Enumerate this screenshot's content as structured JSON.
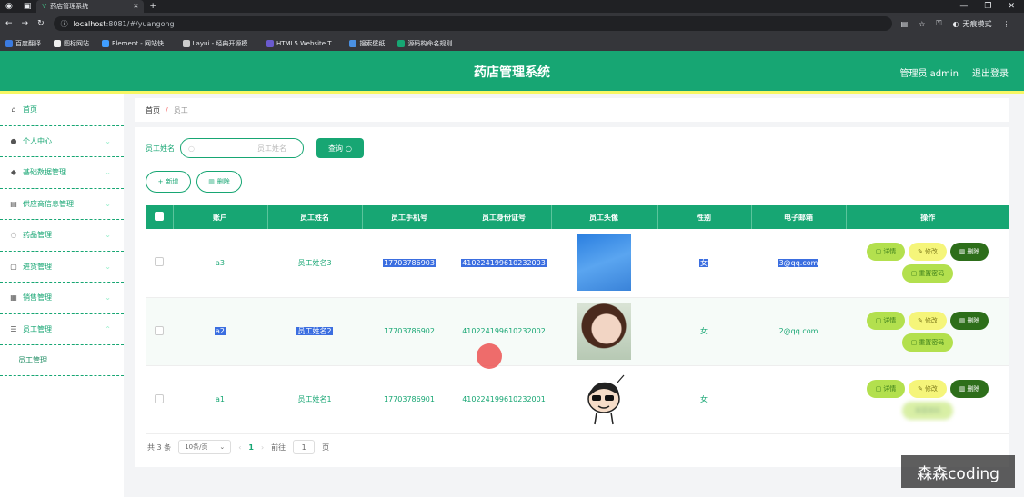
{
  "browser": {
    "tab_title": "药店管理系统",
    "url_host": "localhost",
    "url_rest": ":8081/#/yuangong",
    "incognito_label": "无痕模式",
    "bookmarks": [
      "百度翻译",
      "图标网站",
      "Element - 网站快...",
      "Layui - 经典开源模...",
      "HTML5 Website T...",
      "搜索壁纸",
      "源码构命名规则"
    ]
  },
  "header": {
    "title": "药店管理系统",
    "user": "管理员 admin",
    "logout": "退出登录"
  },
  "sidebar": {
    "items": [
      {
        "label": "首页",
        "icon": "home-icon"
      },
      {
        "label": "个人中心",
        "icon": "user-icon"
      },
      {
        "label": "基础数据管理",
        "icon": "location-icon"
      },
      {
        "label": "供应商信息管理",
        "icon": "printer-icon"
      },
      {
        "label": "药品管理",
        "icon": "circle-icon"
      },
      {
        "label": "进货管理",
        "icon": "chat-icon"
      },
      {
        "label": "销售管理",
        "icon": "doc-icon"
      },
      {
        "label": "员工管理",
        "icon": "menu-icon"
      }
    ],
    "sub_item": "员工管理"
  },
  "breadcrumb": {
    "home": "首页",
    "sep": "/",
    "current": "员工"
  },
  "search": {
    "label": "员工姓名",
    "placeholder": "员工姓名",
    "button": "查询"
  },
  "actions": {
    "add": "新增",
    "delete": "删除"
  },
  "table": {
    "headers": [
      "账户",
      "员工姓名",
      "员工手机号",
      "员工身份证号",
      "员工头像",
      "性别",
      "电子邮箱",
      "操作"
    ],
    "rows": [
      {
        "account": "a3",
        "name": "员工姓名3",
        "phone": "17703786903",
        "id_card": "410224199610232003",
        "gender": "女",
        "email": "3@qq.com"
      },
      {
        "account": "a2",
        "name": "员工姓名2",
        "phone": "17703786902",
        "id_card": "410224199610232002",
        "gender": "女",
        "email": "2@qq.com"
      },
      {
        "account": "a1",
        "name": "员工姓名1",
        "phone": "17703786901",
        "id_card": "410224199610232001",
        "gender": "女",
        "email": ""
      }
    ],
    "op_labels": {
      "detail": "详情",
      "edit": "修改",
      "delete": "删除",
      "reset_pwd": "重置密码"
    }
  },
  "pagination": {
    "total": "共 3 条",
    "page_size": "10条/页",
    "current": "1",
    "goto_prefix": "前往",
    "goto_value": "1",
    "goto_suffix": "页"
  },
  "watermark": "森森coding",
  "colors": {
    "primary": "#17a673",
    "accent_yellow": "#f7f764",
    "delete_dark": "#2d6e1a"
  }
}
